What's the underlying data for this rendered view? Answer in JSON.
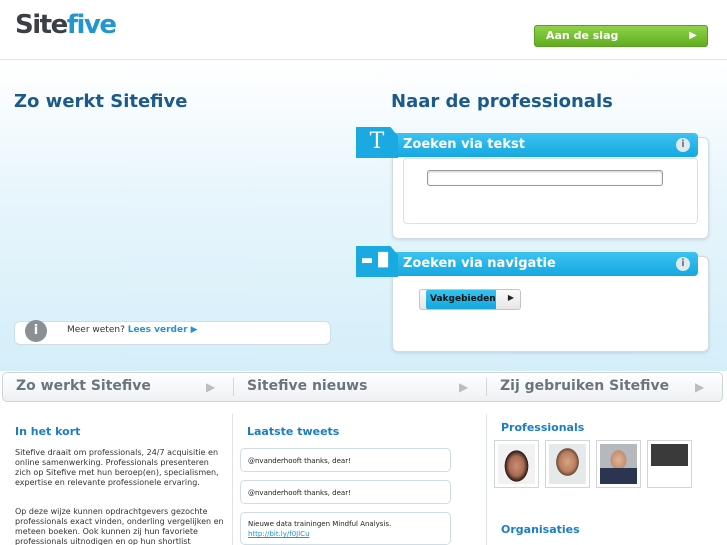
{
  "brand": {
    "logo_part1": "Site",
    "logo_part2": "five"
  },
  "header": {
    "cta_label": "Aan de slag",
    "cta_arrow": "▶"
  },
  "hero": {
    "left_title": "Zo werkt Sitefive",
    "right_title": "Naar de professionals",
    "info_icon": "i",
    "info_text": "Meer weten? ",
    "info_link": "Lees verder ▶"
  },
  "search_text": {
    "tab_glyph": "T",
    "title": "Zoeken via tekst",
    "info_icon": "i",
    "input_value": ""
  },
  "search_nav": {
    "tab_glyph": "▬▐▌",
    "title": "Zoeken via navigatie",
    "info_icon": "i",
    "button_label": "Vakgebieden",
    "button_arrow": "▶"
  },
  "tabs": [
    {
      "label": "Zo werkt Sitefive",
      "arrow": "▶"
    },
    {
      "label": "Sitefive nieuws",
      "arrow": "▶"
    },
    {
      "label": "Zij gebruiken Sitefive",
      "arrow": "▶"
    }
  ],
  "kort": {
    "title": "In het kort",
    "para1": "Sitefive draait om professionals, 24/7 acquisitie en online samenwerking. Professionals presenteren zich op Sitefive met hun beroep(en), specialismen, expertise en relevante professionele ervaring.",
    "para2": "Op deze wijze kunnen opdrachtgevers gezochte professionals exact vinden, onderling vergelijken en meteen boeken. Ook kunnen zij hun favoriete professionals uitnodigen en op hun shortlist"
  },
  "tweets": {
    "title": "Laatste tweets",
    "items": [
      {
        "text": "@nvanderhooft thanks, dear!",
        "link": ""
      },
      {
        "text": "@nvanderhooft thanks, dear!",
        "link": ""
      },
      {
        "text": "Nieuwe data trainingen Mindful Analysis.",
        "link": "http://bit.ly/f0JlCu"
      }
    ]
  },
  "users": {
    "professionals_title": "Professionals",
    "organisaties_title": "Organisaties"
  },
  "colors": {
    "accent": "#1aa9e0",
    "title_blue": "#1b5a8a",
    "cta_green": "#6cbf2a"
  }
}
